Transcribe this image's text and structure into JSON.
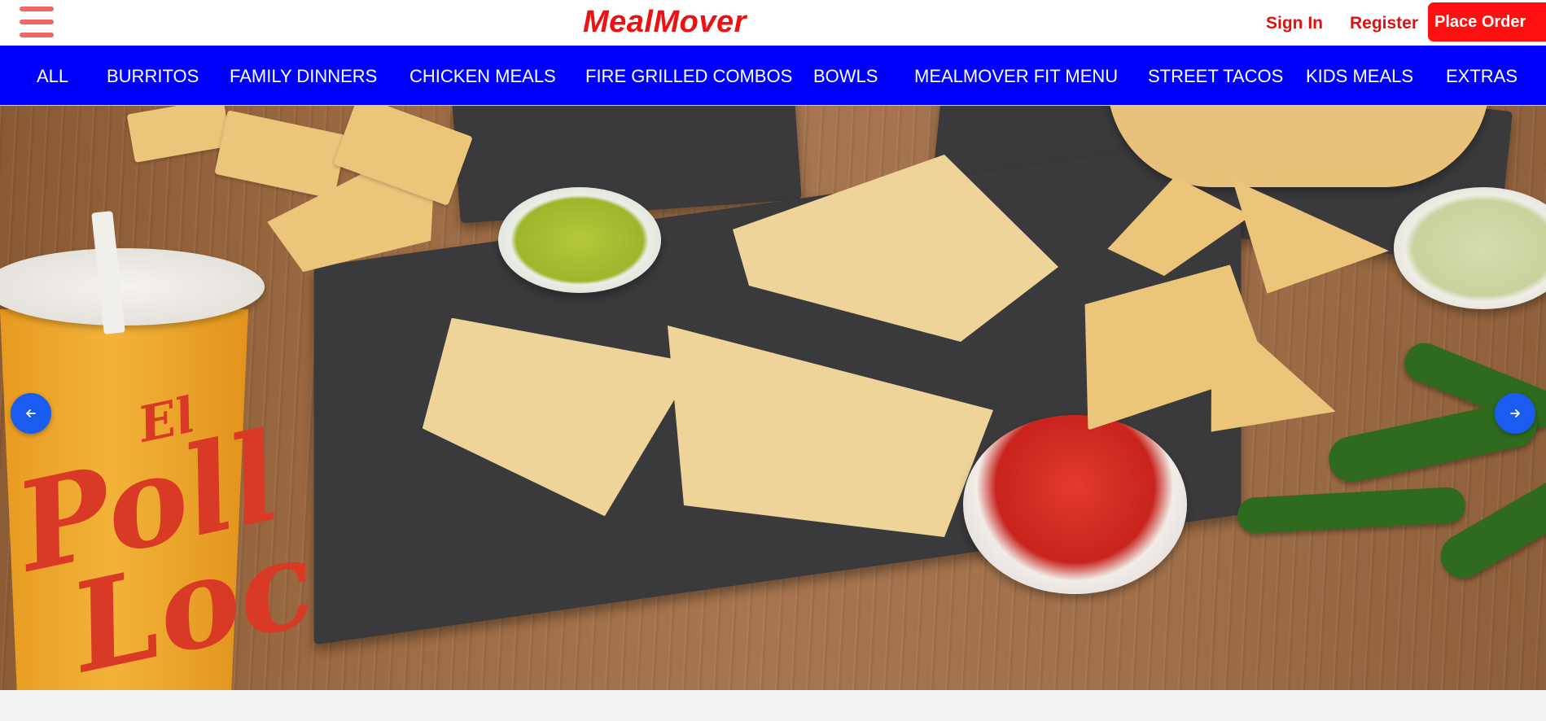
{
  "header": {
    "logo": "MealMover",
    "menu_icon": "hamburger-menu-icon",
    "sign_in": "Sign In",
    "register": "Register",
    "place_order": "Place Order",
    "brand_color": "#ee1111"
  },
  "nav": {
    "background": "#0000ff",
    "items": [
      {
        "label": "ALL"
      },
      {
        "label": "BURRITOS"
      },
      {
        "label": "FAMILY DINNERS"
      },
      {
        "label": "CHICKEN MEALS"
      },
      {
        "label": "FIRE GRILLED COMBOS"
      },
      {
        "label": "BOWLS"
      },
      {
        "label": "MEALMOVER FIT MENU"
      },
      {
        "label": "STREET TACOS"
      },
      {
        "label": "KIDS MEALS"
      },
      {
        "label": "EXTRAS"
      }
    ]
  },
  "hero": {
    "cup_brand": [
      "El",
      "Poll",
      "Loc"
    ],
    "prev_icon": "arrow-left-icon",
    "next_icon": "arrow-right-icon"
  }
}
